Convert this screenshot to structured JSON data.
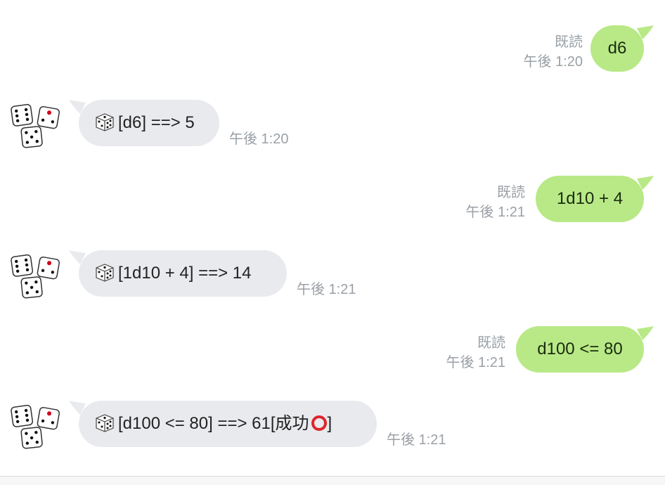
{
  "messages": [
    {
      "side": "out",
      "text": "d6",
      "read": "既読",
      "time": "午後 1:20"
    },
    {
      "side": "in",
      "text": "[d6] ==> 5",
      "time": "午後 1:20",
      "avatar": "dice-avatar-icon"
    },
    {
      "side": "out",
      "text": "1d10 + 4",
      "read": "既読",
      "time": "午後 1:21"
    },
    {
      "side": "in",
      "text": "[1d10 + 4] ==> 14",
      "time": "午後 1:21",
      "avatar": "dice-avatar-icon"
    },
    {
      "side": "out",
      "text": "d100 <= 80",
      "read": "既読",
      "time": "午後 1:21"
    },
    {
      "side": "in",
      "text": "[d100 <= 80] ==> 61[成功",
      "suffix": "]",
      "time": "午後 1:21",
      "avatar": "dice-avatar-icon",
      "status_icon": "red-circle-icon"
    }
  ],
  "colors": {
    "outgoing_bubble": "#b8e986",
    "incoming_bubble": "#e8eaed",
    "meta_text": "#9aa0a6"
  }
}
